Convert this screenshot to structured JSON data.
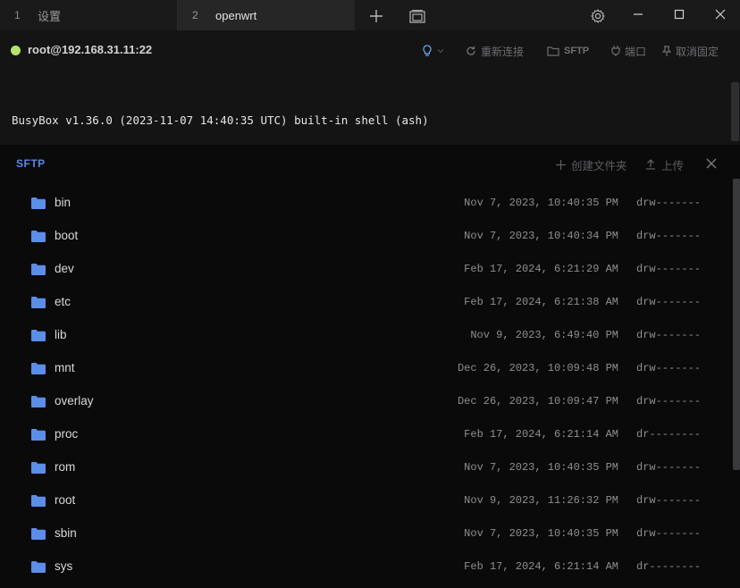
{
  "tabs": [
    {
      "num": "1",
      "label": "设置"
    },
    {
      "num": "2",
      "label": "openwrt"
    }
  ],
  "connection": {
    "host": "root@192.168.31.11:22",
    "status_color": "#b6e36a",
    "reconnect_label": "重新连接",
    "sftp_label": "SFTP",
    "port_label": "端口",
    "unpin_label": "取消固定"
  },
  "terminal": {
    "line": "BusyBox v1.36.0 (2023-11-07 14:40:35 UTC) built-in shell (ash)"
  },
  "sftp": {
    "title": "SFTP",
    "mkdir_label": "创建文件夹",
    "upload_label": "上传",
    "accent_color": "#5e87e6",
    "folder_color": "#5b8ee8",
    "files": [
      {
        "name": "bin",
        "date": "Nov 7, 2023, 10:40:35 PM",
        "perm": "drw-------"
      },
      {
        "name": "boot",
        "date": "Nov 7, 2023, 10:40:34 PM",
        "perm": "drw-------"
      },
      {
        "name": "dev",
        "date": "Feb 17, 2024, 6:21:29 AM",
        "perm": "drw-------"
      },
      {
        "name": "etc",
        "date": "Feb 17, 2024, 6:21:38 AM",
        "perm": "drw-------"
      },
      {
        "name": "lib",
        "date": "Nov 9, 2023, 6:49:40 PM",
        "perm": "drw-------"
      },
      {
        "name": "mnt",
        "date": "Dec 26, 2023, 10:09:48 PM",
        "perm": "drw-------"
      },
      {
        "name": "overlay",
        "date": "Dec 26, 2023, 10:09:47 PM",
        "perm": "drw-------"
      },
      {
        "name": "proc",
        "date": "Feb 17, 2024, 6:21:14 AM",
        "perm": "dr--------"
      },
      {
        "name": "rom",
        "date": "Nov 7, 2023, 10:40:35 PM",
        "perm": "drw-------"
      },
      {
        "name": "root",
        "date": "Nov 9, 2023, 11:26:32 PM",
        "perm": "drw-------"
      },
      {
        "name": "sbin",
        "date": "Nov 7, 2023, 10:40:35 PM",
        "perm": "drw-------"
      },
      {
        "name": "sys",
        "date": "Feb 17, 2024, 6:21:14 AM",
        "perm": "dr--------"
      }
    ]
  }
}
